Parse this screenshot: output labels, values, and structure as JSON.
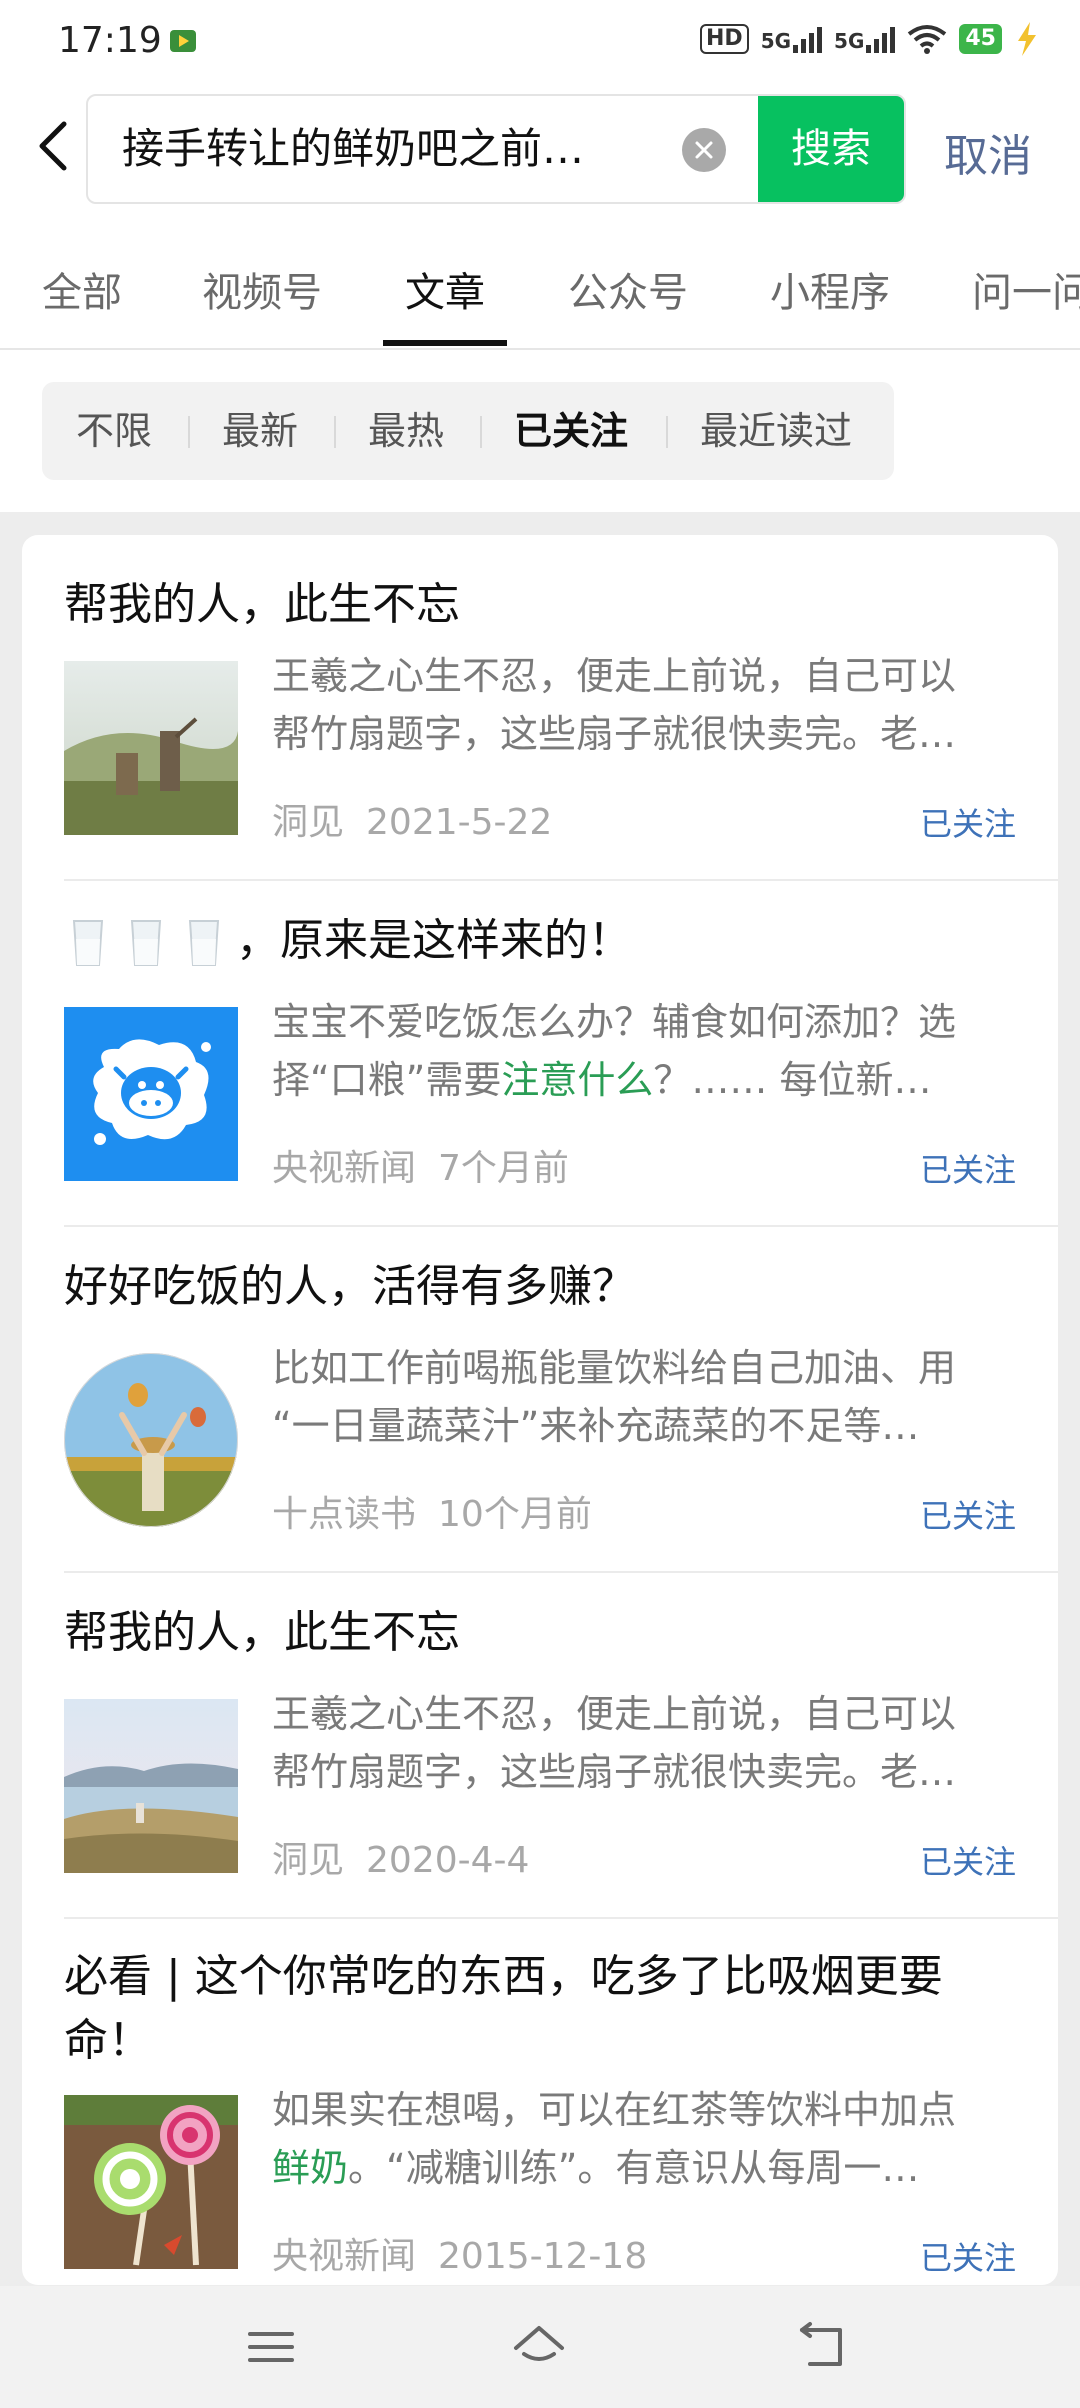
{
  "status_bar": {
    "time": "17:19",
    "hd": "HD",
    "net1": "5G",
    "net2": "5G",
    "battery": "45"
  },
  "search": {
    "query": "接手转让的鲜奶吧之前…",
    "button_label": "搜索",
    "cancel_label": "取消"
  },
  "tabs": [
    {
      "label": "全部",
      "active": false
    },
    {
      "label": "视频号",
      "active": false
    },
    {
      "label": "文章",
      "active": true
    },
    {
      "label": "公众号",
      "active": false
    },
    {
      "label": "小程序",
      "active": false
    },
    {
      "label": "问一问",
      "active": false
    }
  ],
  "filters": [
    {
      "label": "不限",
      "active": false
    },
    {
      "label": "最新",
      "active": false
    },
    {
      "label": "最热",
      "active": false
    },
    {
      "label": "已关注",
      "active": true
    },
    {
      "label": "最近读过",
      "active": false
    }
  ],
  "results": [
    {
      "title": "帮我的人，此生不忘",
      "desc_line1": "王羲之心生不忍，便走上前说，自己可以",
      "desc_line2": "帮竹扇题字，这些扇子就很快卖完。老…",
      "source": "洞见",
      "date": "2021-5-22",
      "followed_label": "已关注",
      "thumb": "landscape-people-image"
    },
    {
      "title": "，原来是这样来的！",
      "desc_line1": "宝宝不爱吃饭怎么办？辅食如何添加？选",
      "desc_line2_pre": "择“口粮”需要",
      "desc_line2_hl": "注意什么",
      "desc_line2_post": "？…… 每位新…",
      "source": "央视新闻",
      "date": "7个月前",
      "followed_label": "已关注",
      "thumb": "milk-cow-icon"
    },
    {
      "title": "好好吃饭的人，活得有多赚？",
      "desc_line1": "比如工作前喝瓶能量饮料给自己加油、用",
      "desc_line2": "“一日量蔬菜汁”来补充蔬菜的不足等…",
      "source": "十点读书",
      "date": "10个月前",
      "followed_label": "已关注",
      "thumb": "balloon-field-image"
    },
    {
      "title": "帮我的人，此生不忘",
      "desc_line1": "王羲之心生不忍，便走上前说，自己可以",
      "desc_line2": "帮竹扇题字，这些扇子就很快卖完。老…",
      "source": "洞见",
      "date": "2020-4-4",
      "followed_label": "已关注",
      "thumb": "lake-grass-image"
    },
    {
      "title_line1": "必看 | 这个你常吃的东西，吃多了比吸烟更要",
      "title_line2": "命！",
      "desc_line1": "如果实在想喝，可以在红茶等饮料中加点",
      "desc_line2_hl": "鲜奶",
      "desc_line2_post": "。“减糖训练”。有意识从每周一…",
      "source": "央视新闻",
      "date": "2015-12-18",
      "followed_label": "已关注",
      "thumb": "lollipop-image"
    }
  ],
  "colors": {
    "search_button": "#07c160",
    "followed_text": "#3e72b8",
    "highlight": "#2a9d55",
    "cancel_text": "#576b95"
  }
}
